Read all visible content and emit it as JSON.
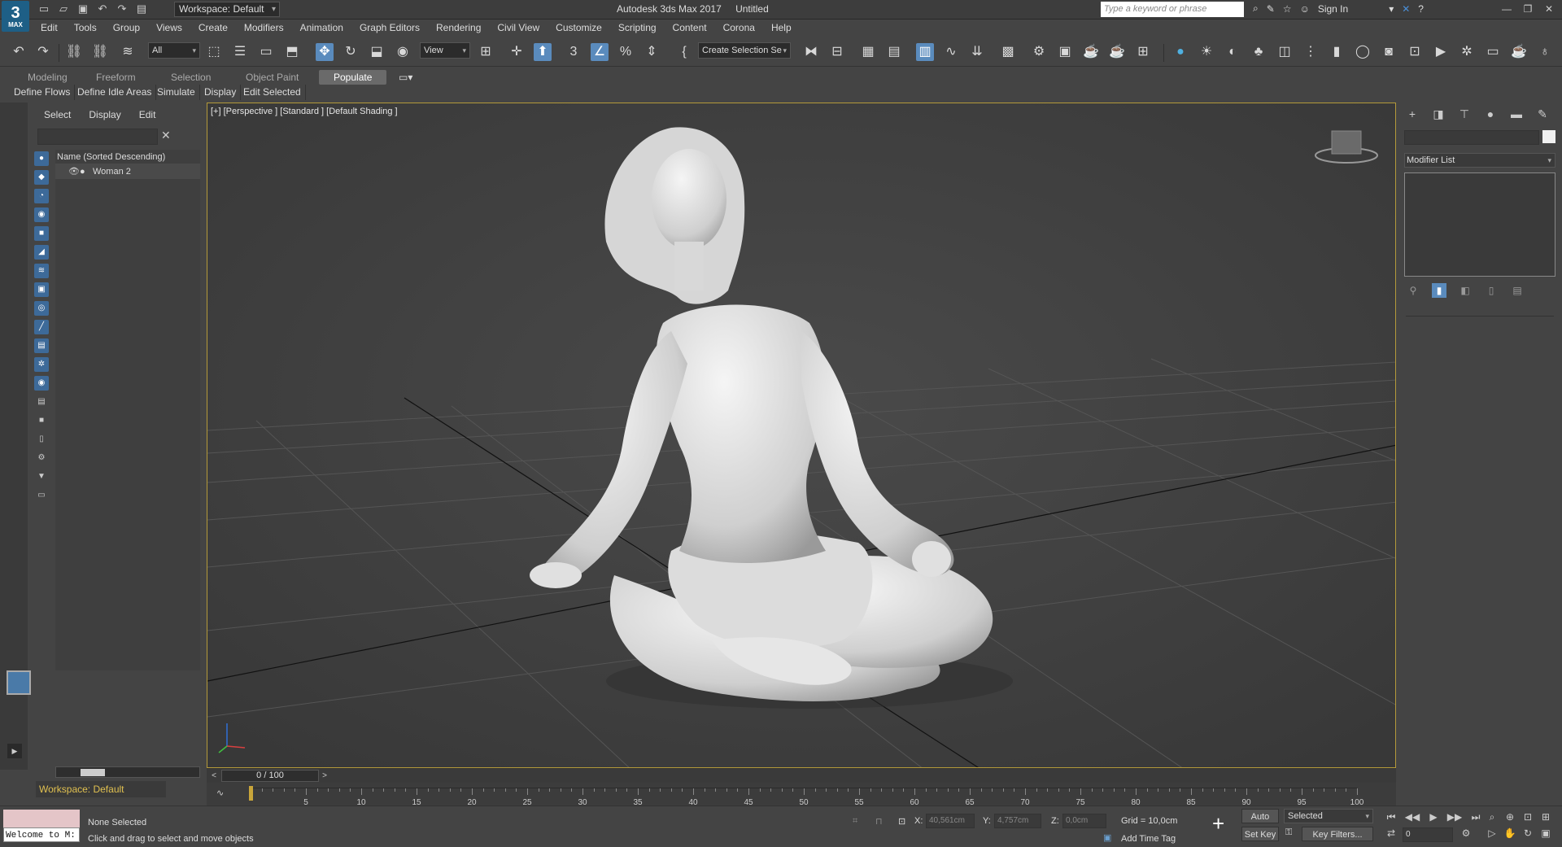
{
  "app": {
    "logo_main": "3",
    "logo_sub": "MAX",
    "title": "Autodesk 3ds Max 2017",
    "document": "Untitled",
    "workspace": "Workspace: Default",
    "search_placeholder": "Type a keyword or phrase",
    "sign_in": "Sign In"
  },
  "menu": [
    "Edit",
    "Tools",
    "Group",
    "Views",
    "Create",
    "Modifiers",
    "Animation",
    "Graph Editors",
    "Rendering",
    "Civil View",
    "Customize",
    "Scripting",
    "Content",
    "Corona",
    "Help"
  ],
  "toolbar": {
    "filter": "All",
    "ref_coord": "View",
    "selection_set": "Create Selection Se"
  },
  "ribbon": {
    "tabs": [
      "Modeling",
      "Freeform",
      "Selection",
      "Object Paint",
      "Populate"
    ],
    "active_tab": "Populate",
    "sub_tabs": [
      "Define Flows",
      "Define Idle Areas",
      "Simulate",
      "Display",
      "Edit Selected"
    ]
  },
  "scene_explorer": {
    "tabs": [
      "Select",
      "Display",
      "Edit"
    ],
    "header": "Name (Sorted Descending)",
    "items": [
      {
        "name": "Woman 2"
      }
    ],
    "workspace": "Workspace: Default"
  },
  "viewport": {
    "label": "[+] [Perspective ] [Standard ] [Default Shading ]",
    "background": "#424242",
    "border_color": "#b49a3a"
  },
  "command_panel": {
    "modifier_list": "Modifier List"
  },
  "timeline": {
    "frame": "0 / 100",
    "ticks": [
      5,
      10,
      15,
      20,
      25,
      30,
      35,
      40,
      45,
      50,
      55,
      60,
      65,
      70,
      75,
      80,
      85,
      90,
      95,
      100
    ]
  },
  "status": {
    "welcome": "Welcome to M:",
    "selection": "None Selected",
    "prompt": "Click and drag to select and move objects",
    "x_label": "X:",
    "x_value": "40,561cm",
    "y_label": "Y:",
    "y_value": "4,757cm",
    "z_label": "Z:",
    "z_value": "0,0cm",
    "grid": "Grid = 10,0cm",
    "add_time_tag": "Add Time Tag",
    "auto_key": "Auto Key",
    "set_key": "Set Key",
    "key_mode": "Selected",
    "key_filters": "Key Filters...",
    "current_frame": "0"
  }
}
